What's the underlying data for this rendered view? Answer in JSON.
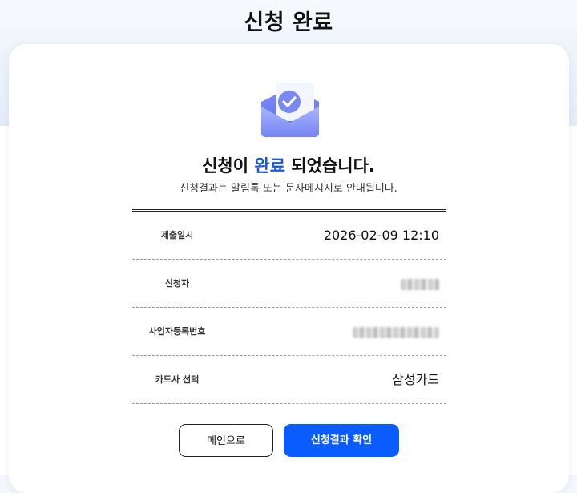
{
  "page": {
    "title": "신청 완료"
  },
  "confirmation": {
    "headline_prefix": "신청이 ",
    "headline_accent": "완료",
    "headline_suffix": " 되었습니다.",
    "subtext": "신청결과는 알림톡 또는 문자메시지로 안내됩니다.",
    "icon": "envelope-check-icon",
    "accent_color": "#1a56e8"
  },
  "details": {
    "rows": [
      {
        "label": "제출일시",
        "value": "2026-02-09 12:10",
        "masked": false
      },
      {
        "label": "신청자",
        "value": "",
        "masked": true
      },
      {
        "label": "사업자등록번호",
        "value": "",
        "masked": true
      },
      {
        "label": "카드사 선택",
        "value": "삼성카드",
        "masked": false
      }
    ]
  },
  "actions": {
    "main_label": "메인으로",
    "result_label": "신청결과 확인",
    "primary_color": "#0a5cff"
  }
}
